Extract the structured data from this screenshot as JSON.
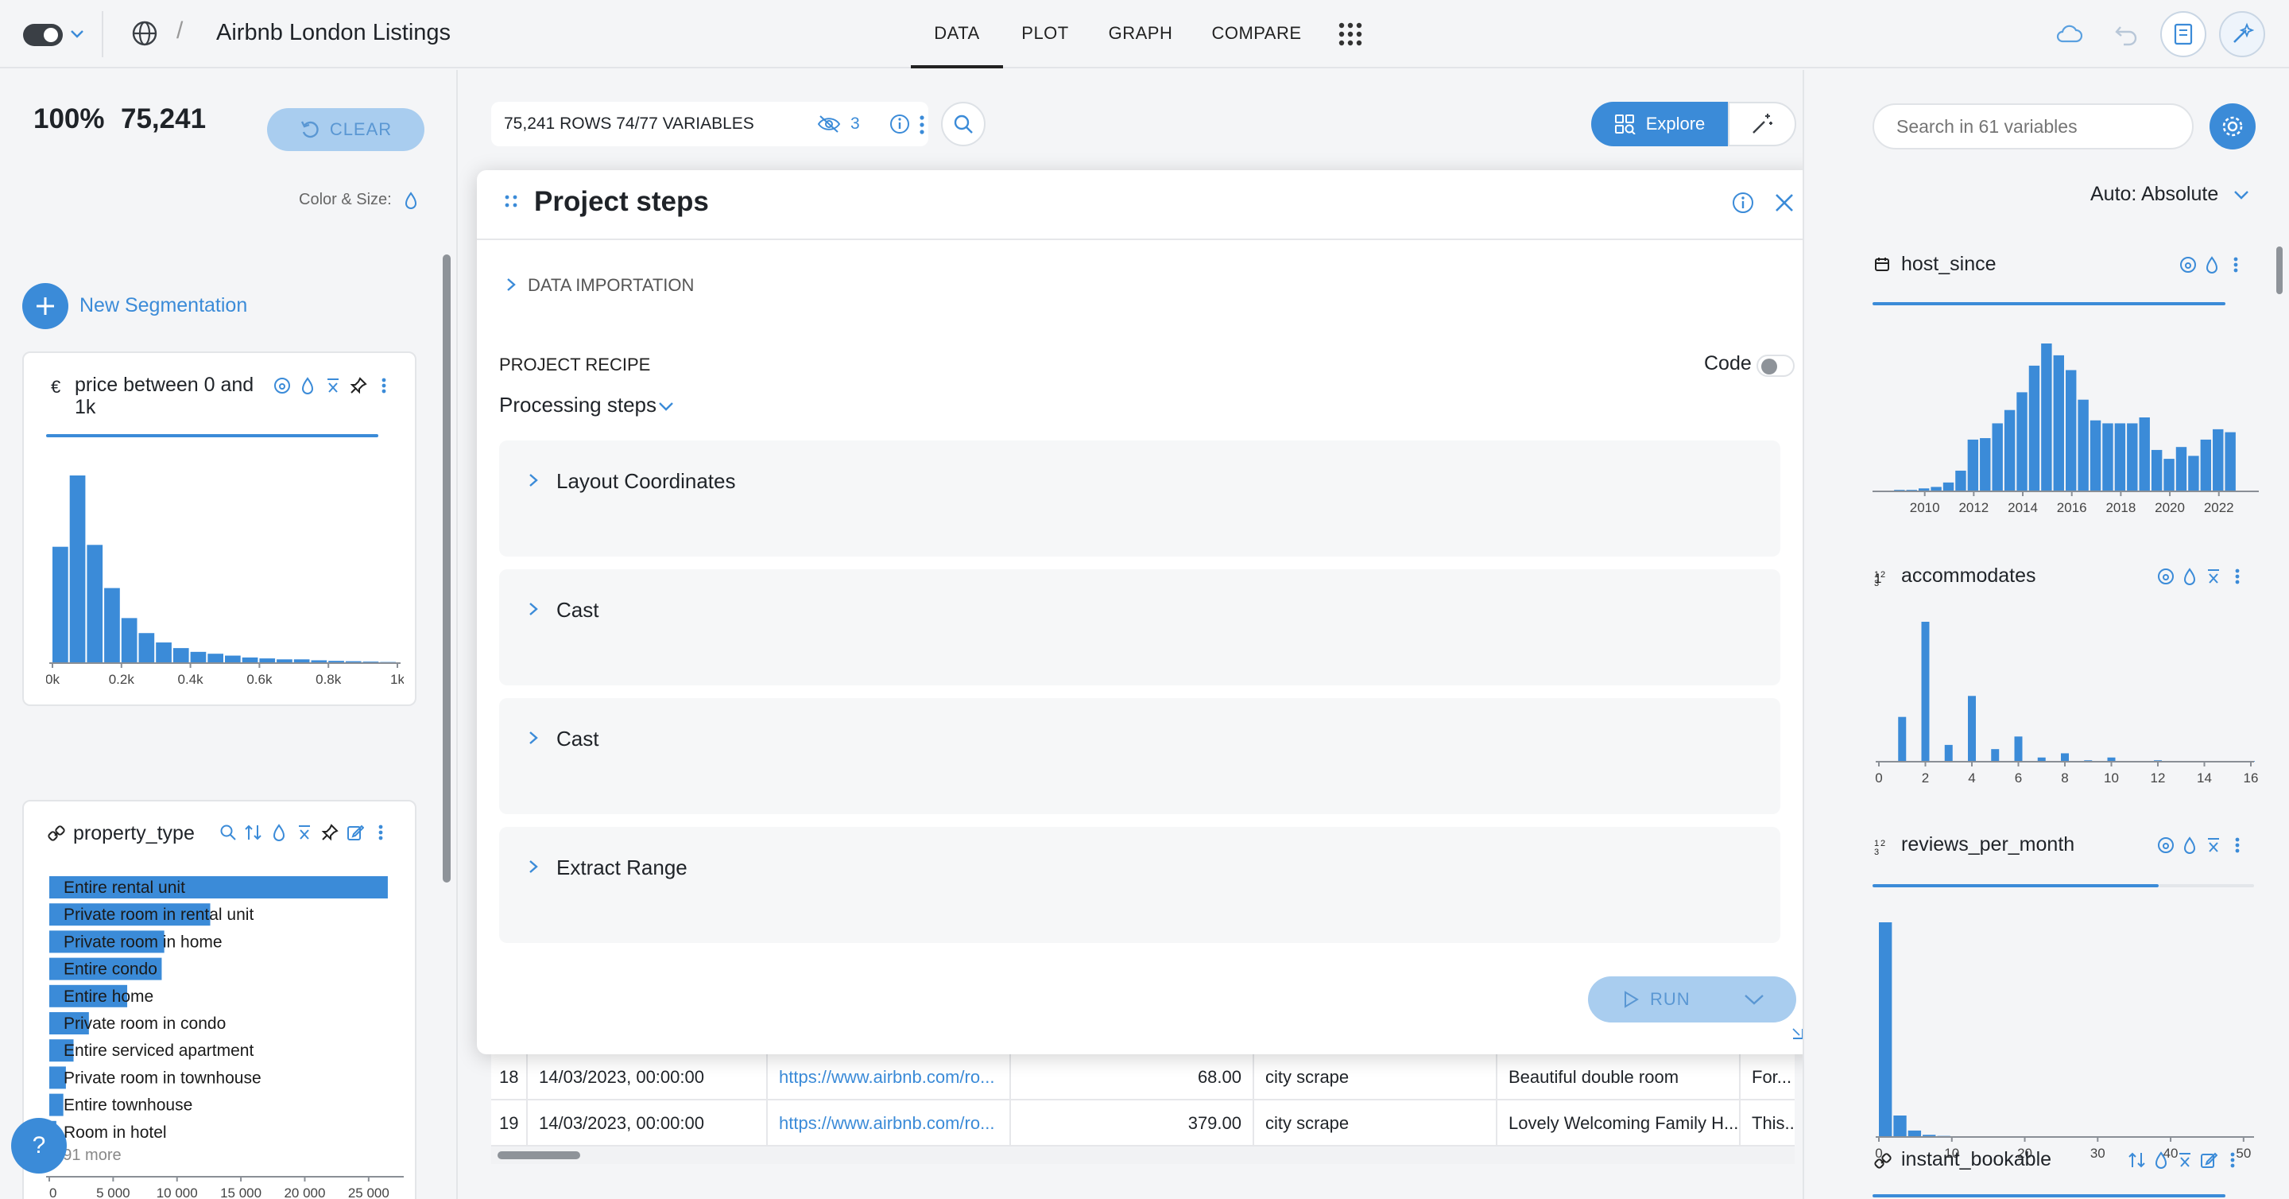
{
  "app": {
    "title": "Airbnb London Listings",
    "breadcrumb_sep": "/",
    "tabs": [
      "DATA",
      "PLOT",
      "GRAPH",
      "COMPARE"
    ],
    "active_tab": "DATA"
  },
  "left": {
    "percent": "100%",
    "count": "75,241",
    "clear_label": "CLEAR",
    "color_size_label": "Color & Size:",
    "new_segmentation": "New Segmentation",
    "price_card": {
      "currency": "€",
      "title": "price between 0 and 1k",
      "x_ticks": [
        "0k",
        "0.2k",
        "0.4k",
        "0.6k",
        "0.8k",
        "1k"
      ]
    },
    "property_card": {
      "title": "property_type",
      "more": "+ 91 more",
      "x_ticks": [
        "0",
        "5 000",
        "10 000",
        "15 000",
        "20 000",
        "25 000"
      ]
    },
    "help": "?"
  },
  "center": {
    "rows_info": "75,241 ROWS 74/77 VARIABLES",
    "hidden_count": "3",
    "explore_label": "Explore",
    "modal": {
      "title": "Project steps",
      "data_importation": "DATA IMPORTATION",
      "project_recipe": "PROJECT RECIPE",
      "code_label": "Code",
      "processing_steps": "Processing steps",
      "steps": [
        "Layout Coordinates",
        "Cast",
        "Cast",
        "Extract Range"
      ],
      "run_label": "RUN"
    },
    "table_rows": [
      {
        "idx": "18",
        "date": "14/03/2023, 00:00:00",
        "url": "https://www.airbnb.com/ro...",
        "price": "68.00",
        "source": "city scrape",
        "name": "Beautiful double room",
        "desc": "For..."
      },
      {
        "idx": "19",
        "date": "14/03/2023, 00:00:00",
        "url": "https://www.airbnb.com/ro...",
        "price": "379.00",
        "source": "city scrape",
        "name": "Lovely Welcoming Family H...",
        "desc": "This..."
      }
    ]
  },
  "right": {
    "search_placeholder": "Search in 61 variables",
    "mode_label": "Auto: Absolute",
    "host_since": {
      "title": "host_since",
      "x_ticks": [
        "2010",
        "2012",
        "2014",
        "2016",
        "2018",
        "2020",
        "2022"
      ]
    },
    "accommodates": {
      "title": "accommodates",
      "x_ticks": [
        "0",
        "2",
        "4",
        "6",
        "8",
        "10",
        "12",
        "14",
        "16"
      ]
    },
    "reviews": {
      "title": "reviews_per_month",
      "x_ticks": [
        "0",
        "10",
        "20",
        "30",
        "40",
        "50"
      ]
    },
    "instant": {
      "title": "instant_bookable"
    }
  },
  "chart_data": [
    {
      "type": "bar",
      "title": "price between 0 and 1k",
      "x": [
        0,
        50,
        100,
        150,
        200,
        250,
        300,
        350,
        400,
        450,
        500,
        550,
        600,
        650,
        700,
        750,
        800,
        850,
        900,
        950
      ],
      "values": [
        62,
        100,
        63,
        40,
        24,
        16,
        11,
        8,
        6,
        5,
        4,
        3,
        2.5,
        2,
        2,
        1.5,
        1.2,
        1,
        0.8,
        0.6
      ],
      "xlim": [
        0,
        1000
      ]
    },
    {
      "type": "bar",
      "title": "property_type",
      "categories": [
        "Entire rental unit",
        "Private room in rental unit",
        "Private room in home",
        "Entire condo",
        "Entire home",
        "Private room in condo",
        "Entire serviced apartment",
        "Private room in townhouse",
        "Entire townhouse",
        "Room in hotel"
      ],
      "values": [
        26500,
        12600,
        9000,
        8800,
        6100,
        3100,
        1900,
        1300,
        1100,
        550
      ],
      "xlim": [
        0,
        27500
      ]
    },
    {
      "type": "bar",
      "title": "host_since",
      "x": [
        2008.5,
        2009,
        2009.5,
        2010,
        2010.5,
        2011,
        2011.5,
        2012,
        2012.5,
        2013,
        2013.5,
        2014,
        2014.5,
        2015,
        2015.5,
        2016,
        2016.5,
        2017,
        2017.5,
        2018,
        2018.5,
        2019,
        2019.5,
        2020,
        2020.5,
        2021,
        2021.5,
        2022,
        2022.5,
        2023
      ],
      "values": [
        0,
        1,
        1,
        2,
        3,
        6,
        14,
        35,
        36,
        46,
        55,
        67,
        85,
        100,
        92,
        82,
        62,
        48,
        46,
        46,
        46,
        50,
        28,
        22,
        30,
        24,
        35,
        42,
        40,
        0
      ],
      "xlim": [
        2008,
        2023.5
      ]
    },
    {
      "type": "bar",
      "title": "accommodates",
      "x": [
        1,
        2,
        3,
        4,
        5,
        6,
        7,
        8,
        9,
        10,
        11,
        12,
        13,
        14,
        15,
        16
      ],
      "values": [
        32,
        100,
        12,
        47,
        9,
        18,
        3,
        6,
        1,
        3,
        0.5,
        1,
        0,
        0.5,
        0,
        0.5
      ],
      "xlim": [
        0,
        16
      ]
    },
    {
      "type": "bar",
      "title": "reviews_per_month",
      "x": [
        0,
        2,
        4,
        6,
        8,
        10
      ],
      "values": [
        100,
        10,
        3,
        1,
        0.5,
        0.2
      ],
      "xlim": [
        0,
        51
      ]
    }
  ]
}
